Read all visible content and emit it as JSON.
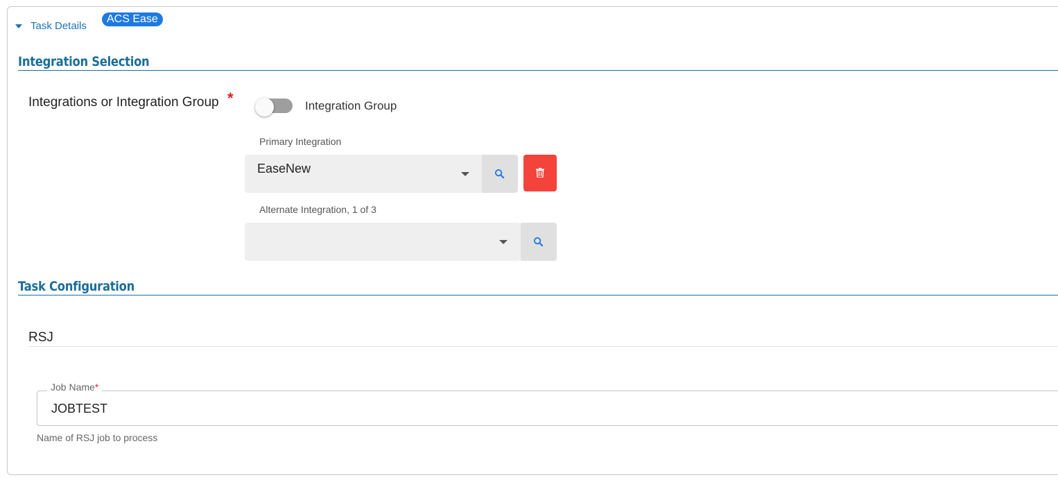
{
  "header": {
    "toggle_label": "Task Details",
    "badge": "ACS Ease"
  },
  "integration_selection": {
    "title": "Integration Selection",
    "field_label": "Integrations or Integration Group",
    "required_mark": "*",
    "toggle": {
      "label": "Integration Group",
      "on": false
    },
    "primary": {
      "label": "Primary Integration",
      "value": "EaseNew"
    },
    "alternate": {
      "label": "Alternate Integration, 1 of 3",
      "value": ""
    }
  },
  "task_configuration": {
    "title": "Task Configuration",
    "subsection": "RSJ",
    "job_name": {
      "label": "Job Name",
      "required_mark": "*",
      "value": "JOBTEST",
      "helper": "Name of RSJ job to process"
    }
  },
  "colors": {
    "accent": "#1a73b8",
    "section": "#1a6e98",
    "badge": "#1f7ae0",
    "danger": "#f4433b",
    "required": "#e02020"
  },
  "icons": [
    "caret-down-icon",
    "chevron-down-icon",
    "search-icon",
    "trash-icon"
  ]
}
